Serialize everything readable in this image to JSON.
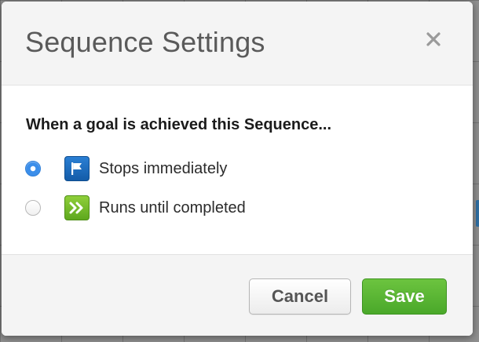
{
  "dialog": {
    "title": "Sequence Settings",
    "close_icon": "close-icon"
  },
  "body": {
    "question": "When a goal is achieved this Sequence...",
    "options": [
      {
        "label": "Stops immediately",
        "icon": "flag-icon",
        "selected": true
      },
      {
        "label": "Runs until completed",
        "icon": "double-chevron-right-icon",
        "selected": false
      }
    ]
  },
  "footer": {
    "cancel_label": "Cancel",
    "save_label": "Save"
  },
  "colors": {
    "save_button": "#5cb833",
    "radio_selected": "#3b8eea",
    "flag_icon_bg": "#1f6fc2",
    "arrows_icon_bg": "#76bd2c"
  }
}
